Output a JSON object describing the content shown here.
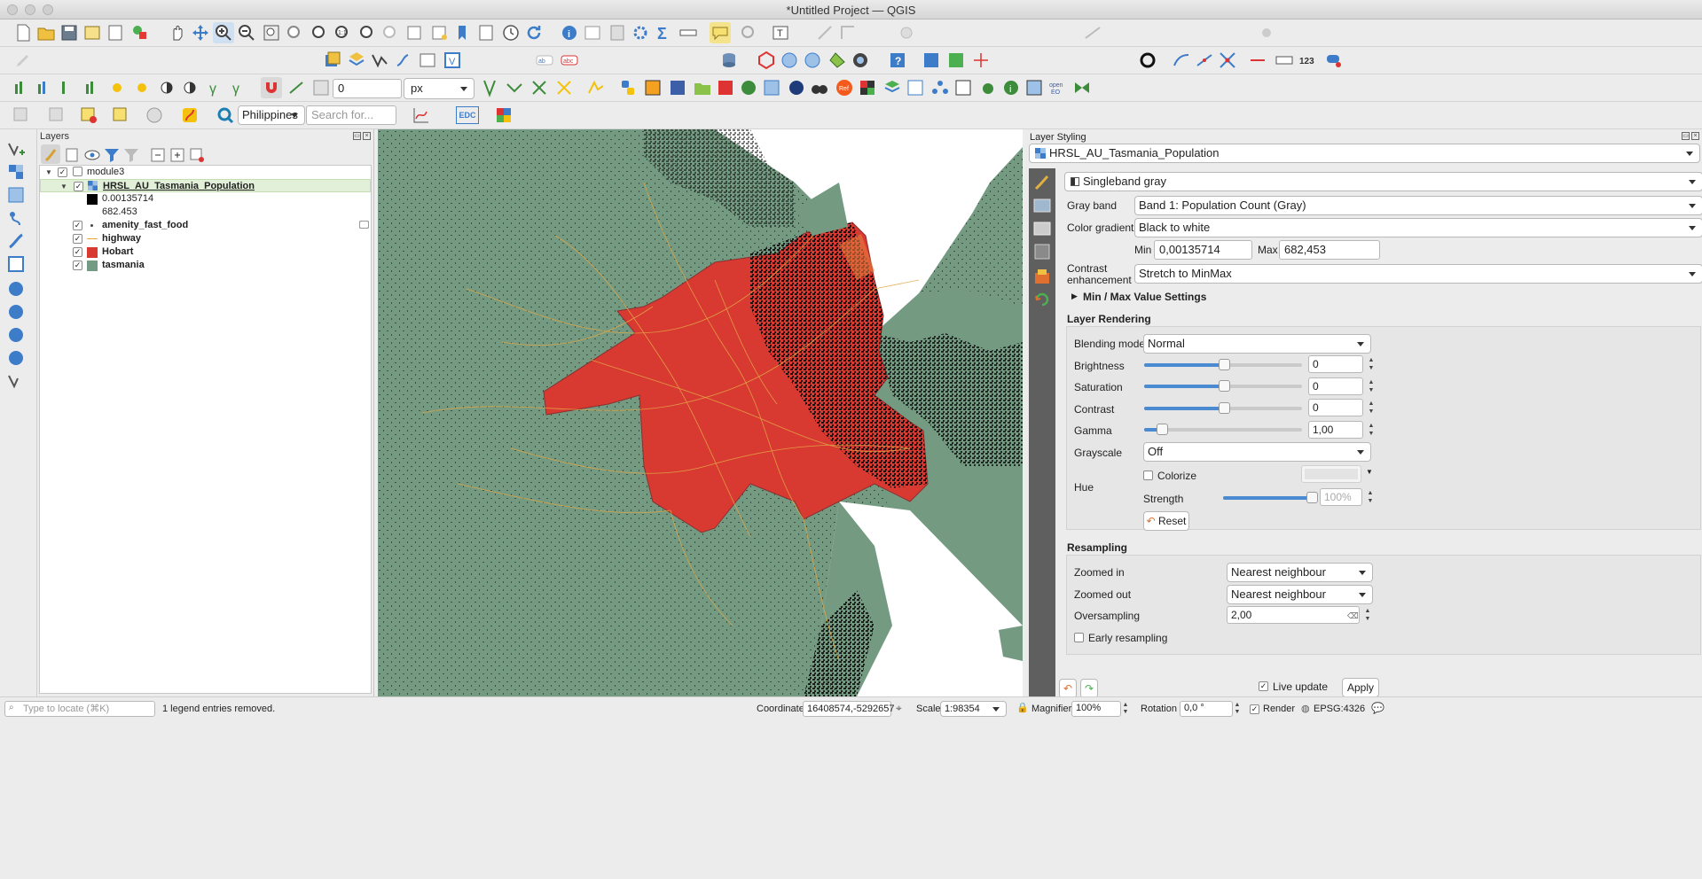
{
  "window": {
    "title": "*Untitled Project — QGIS"
  },
  "toolbar": {
    "snap_tolerance_value": "0",
    "snap_unit": "px",
    "locator_country": "Philippines",
    "search_placeholder": "Search for...",
    "edc_label": "EDC"
  },
  "layers_panel": {
    "title": "Layers",
    "group_name": "module3",
    "items": [
      {
        "name": "HRSL_AU_Tasmania_Population",
        "checked": true,
        "color": "#222222"
      },
      {
        "name": "amenity_fast_food",
        "checked": true,
        "color": "#444444"
      },
      {
        "name": "highway",
        "checked": true,
        "color": "#e8a640"
      },
      {
        "name": "Hobart",
        "checked": true,
        "color": "#d83a32"
      },
      {
        "name": "tasmania",
        "checked": true,
        "color": "#739a83"
      }
    ],
    "legend": {
      "min": "0.00135714",
      "max": "682.453"
    }
  },
  "styling": {
    "title": "Layer Styling",
    "layer_select": "HRSL_AU_Tasmania_Population",
    "renderer": "Singleband gray",
    "gray_band_label": "Gray band",
    "gray_band_value": "Band 1: Population Count (Gray)",
    "color_gradient_label": "Color gradient",
    "color_gradient_value": "Black to white",
    "min_label": "Min",
    "min_value": "0,00135714",
    "max_label": "Max",
    "max_value": "682,453",
    "contrast_label_1": "Contrast",
    "contrast_label_2": "enhancement",
    "contrast_value": "Stretch to MinMax",
    "minmax_section": "Min / Max Value Settings",
    "layer_rendering": "Layer Rendering",
    "blending_label": "Blending mode",
    "blending_value": "Normal",
    "brightness_label": "Brightness",
    "brightness_value": "0",
    "saturation_label": "Saturation",
    "saturation_value": "0",
    "contrast2_label": "Contrast",
    "contrast2_value": "0",
    "gamma_label": "Gamma",
    "gamma_value": "1,00",
    "grayscale_label": "Grayscale",
    "grayscale_value": "Off",
    "hue_label": "Hue",
    "colorize_label": "Colorize",
    "strength_label": "Strength",
    "strength_value": "100%",
    "reset_label": "Reset",
    "resampling_title": "Resampling",
    "zoomed_in_label": "Zoomed in",
    "zoomed_in_value": "Nearest neighbour",
    "zoomed_out_label": "Zoomed out",
    "zoomed_out_value": "Nearest neighbour",
    "oversampling_label": "Oversampling",
    "oversampling_value": "2,00",
    "early_resampling_label": "Early resampling",
    "live_update_label": "Live update",
    "apply_label": "Apply"
  },
  "statusbar": {
    "locate_placeholder": "Type to locate (⌘K)",
    "message": "1 legend entries removed.",
    "coordinate_label": "Coordinate",
    "coordinate_value": "16408574,-5292657",
    "scale_label": "Scale",
    "scale_value": "1:98354",
    "magnifier_label": "Magnifier",
    "magnifier_value": "100%",
    "rotation_label": "Rotation",
    "rotation_value": "0,0 °",
    "render_label": "Render",
    "crs_label": "EPSG:4326"
  }
}
